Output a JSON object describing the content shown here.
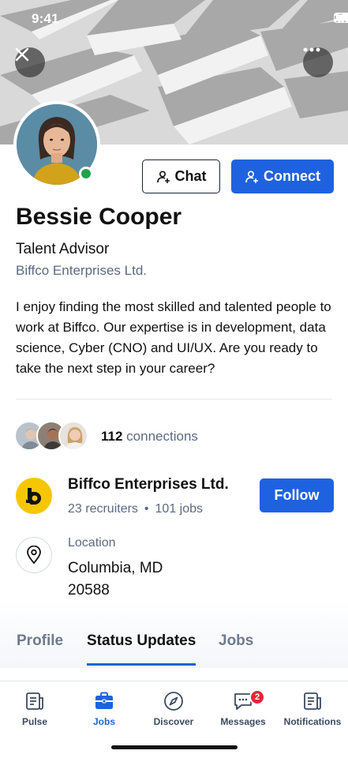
{
  "status_bar": {
    "time": "9:41"
  },
  "header": {
    "close_icon": "close-icon",
    "more_icon": "more-icon"
  },
  "profile": {
    "name": "Bessie Cooper",
    "role": "Talent Advisor",
    "company": "Biffco Enterprises Ltd.",
    "bio": "I enjoy finding the most skilled and talented people to work at Biffco. Our expertise is in development, data science, Cyber (CNO) and UI/UX. Are you ready to take the next step in your career?",
    "online": true
  },
  "actions": {
    "chat_label": "Chat",
    "connect_label": "Connect"
  },
  "connections": {
    "count": "112",
    "label": "connections"
  },
  "company_card": {
    "name": "Biffco Enterprises Ltd.",
    "recruiters": "23 recruiters",
    "separator": "•",
    "jobs": "101 jobs",
    "follow_label": "Follow"
  },
  "location": {
    "label": "Location",
    "value_line1": "Columbia, MD",
    "value_line2": "20588"
  },
  "tabs": [
    {
      "label": "Profile",
      "active": false
    },
    {
      "label": "Status Updates",
      "active": true
    },
    {
      "label": "Jobs",
      "active": false
    }
  ],
  "bottom_nav": [
    {
      "label": "Pulse",
      "icon": "pulse-icon",
      "active": false
    },
    {
      "label": "Jobs",
      "icon": "briefcase-icon",
      "active": true
    },
    {
      "label": "Discover",
      "icon": "compass-icon",
      "active": false
    },
    {
      "label": "Messages",
      "icon": "messages-icon",
      "active": false,
      "badge": "2"
    },
    {
      "label": "Notifications",
      "icon": "notifications-icon",
      "active": false
    }
  ],
  "colors": {
    "primary": "#1f62e0",
    "online": "#1fa34a",
    "badge": "#e5263b",
    "company_logo": "#f6c700"
  }
}
